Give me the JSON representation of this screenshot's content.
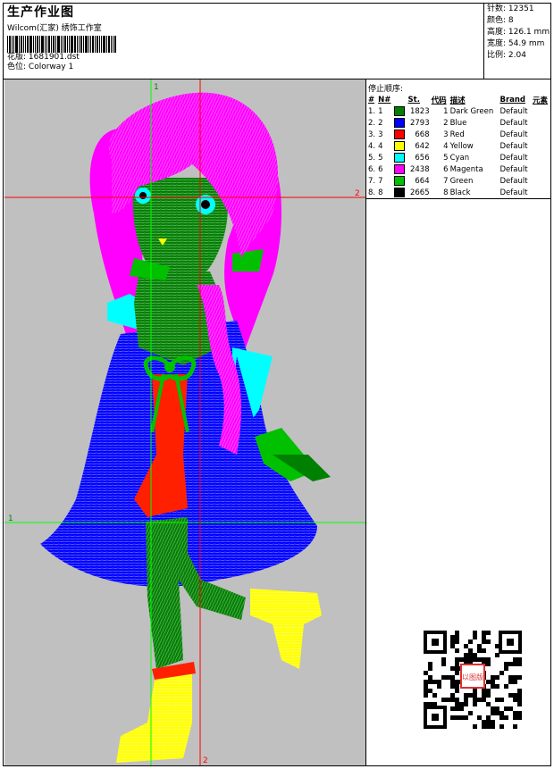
{
  "header": {
    "title": "生产作业图",
    "company": "Wilcom(汇家) 绣饰工作室",
    "file_label": "花版:",
    "file_name": "1681901.dst",
    "colorway_label": "色位:",
    "colorway_name": "Colorway 1"
  },
  "stats": [
    {
      "label": "针数:",
      "value": "12351"
    },
    {
      "label": "颜色:",
      "value": "8"
    },
    {
      "label": "高度:",
      "value": "126.1 mm"
    },
    {
      "label": "宽度:",
      "value": "54.9 mm"
    },
    {
      "label": "比例:",
      "value": "2.04"
    }
  ],
  "color_panel": {
    "title": "停止顺序:",
    "columns": [
      "#",
      "N#",
      "St.",
      "代码",
      "描述",
      "Brand",
      "元素"
    ],
    "rows": [
      {
        "idx": "1.",
        "n": "1",
        "color": "#008000",
        "st": "1823",
        "code": "1",
        "desc": "Dark Green",
        "brand": "Default"
      },
      {
        "idx": "2.",
        "n": "2",
        "color": "#0000ff",
        "st": "2793",
        "code": "2",
        "desc": "Blue",
        "brand": "Default"
      },
      {
        "idx": "3.",
        "n": "3",
        "color": "#ff0000",
        "st": "668",
        "code": "3",
        "desc": "Red",
        "brand": "Default"
      },
      {
        "idx": "4.",
        "n": "4",
        "color": "#ffff00",
        "st": "642",
        "code": "4",
        "desc": "Yellow",
        "brand": "Default"
      },
      {
        "idx": "5.",
        "n": "5",
        "color": "#00ffff",
        "st": "656",
        "code": "5",
        "desc": "Cyan",
        "brand": "Default"
      },
      {
        "idx": "6.",
        "n": "6",
        "color": "#ff00ff",
        "st": "2438",
        "code": "6",
        "desc": "Magenta",
        "brand": "Default"
      },
      {
        "idx": "7.",
        "n": "7",
        "color": "#00c000",
        "st": "664",
        "code": "7",
        "desc": "Green",
        "brand": "Default"
      },
      {
        "idx": "8.",
        "n": "8",
        "color": "#000000",
        "st": "2665",
        "code": "8",
        "desc": "Black",
        "brand": "Default"
      }
    ]
  },
  "guides": {
    "green_top": "1",
    "green_left": "1",
    "red_right": "2",
    "red_bottom": "2"
  },
  "qr_stamp": "以图版"
}
